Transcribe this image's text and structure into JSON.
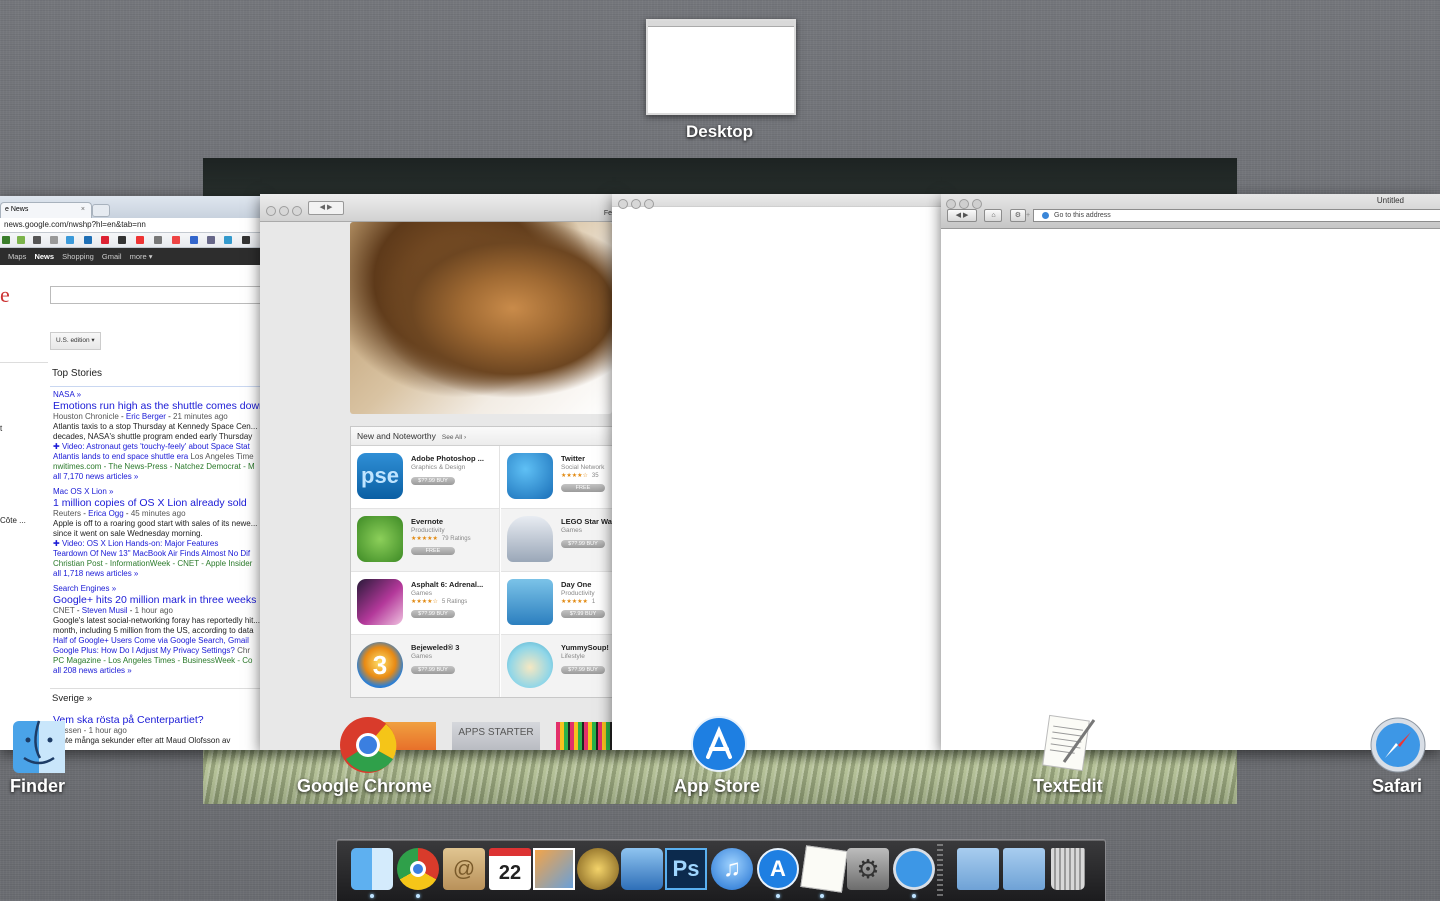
{
  "desktop": {
    "label": "Desktop"
  },
  "app_labels": {
    "finder": "Finder",
    "chrome": "Google Chrome",
    "appstore": "App Store",
    "textedit": "TextEdit",
    "safari": "Safari"
  },
  "chrome_window": {
    "tab_title": "e News",
    "url": "news.google.com/nwshp?hl=en&tab=nn",
    "gbar": [
      "Maps",
      "News",
      "Shopping",
      "Gmail",
      "more ▾"
    ],
    "edition": "U.S. edition ▾",
    "top_stories": "Top Stories",
    "stories": [
      {
        "section": "NASA »",
        "headline": "Emotions run high as the shuttle comes down",
        "source": "Houston Chronicle",
        "author": "Eric Berger",
        "time": "21 minutes ago",
        "snippet": "Atlantis taxis to a stop Thursday at Kennedy Space Cen... decades, NASA's shuttle program ended early Thursday",
        "video": "Video: Astronaut gets 'touchy-feely' about Space Stat",
        "related": "Atlantis lands to end space shuttle era",
        "related_src": "Los Angeles Time",
        "more_src": "nwitimes.com - The News-Press - Natchez Democrat - M",
        "all": "all 7,170 news articles »"
      },
      {
        "section": "Mac OS X Lion »",
        "headline": "1 million copies of OS X Lion already sold",
        "source": "Reuters",
        "author": "Erica Ogg",
        "time": "45 minutes ago",
        "snippet": "Apple is off to a roaring good start with sales of its newe... since it went on sale Wednesday morning.",
        "video": "Video: OS X Lion Hands-on: Major Features",
        "related": "Teardown Of New 13\" MacBook Air Finds Almost No Dif",
        "related_src": "",
        "more_src": "Christian Post - InformationWeek - CNET - Apple Insider",
        "all": "all 1,718 news articles »"
      },
      {
        "section": "Search Engines »",
        "headline": "Google+ hits 20 million mark in three weeks",
        "source": "CNET",
        "author": "Steven Musil",
        "time": "1 hour ago",
        "snippet": "Google's latest social-networking foray has reportedly hit... month, including 5 million from the US, according to data",
        "video": "Half of Google+ Users Come via Google Search, Gmail",
        "related": "Google Plus: How Do I Adjust My Privacy Settings?",
        "related_src": "Chr",
        "more_src": "PC Magazine - Los Angeles Times - BusinessWeek - Co",
        "all": "all 208 news articles »"
      }
    ],
    "sverige": "Sverige »",
    "sverige_headline": "Vem ska rösta på Centerpartiet?",
    "sverige_src": "pressen - 1 hour ago",
    "sverige_snippet": "g inte många sekunder efter att Maud Olofsson av",
    "left_fragments": [
      "t",
      "Côte ..."
    ]
  },
  "appstore_window": {
    "title_fragment": "Fe",
    "nn_title": "New and Noteworthy",
    "see_all": "See All ›",
    "apps": [
      {
        "name": "Adobe Photoshop ...",
        "cat": "Graphics & Design",
        "stars": "",
        "ratings": "",
        "price": "$??.99 BUY"
      },
      {
        "name": "Twitter",
        "cat": "Social Network",
        "stars": "★★★★☆",
        "ratings": "35",
        "price": "FREE"
      },
      {
        "name": "Evernote",
        "cat": "Productivity",
        "stars": "★★★★★",
        "ratings": "79 Ratings",
        "price": "FREE"
      },
      {
        "name": "LEGO Star Wa",
        "cat": "Games",
        "stars": "",
        "ratings": "",
        "price": "$??.99 BUY"
      },
      {
        "name": "Asphalt 6: Adrenal...",
        "cat": "Games",
        "stars": "★★★★☆",
        "ratings": "5 Ratings",
        "price": "$??.99 BUY"
      },
      {
        "name": "Day One",
        "cat": "Productivity",
        "stars": "★★★★★",
        "ratings": "1",
        "price": "$?.99 BUY"
      },
      {
        "name": "Bejeweled® 3",
        "cat": "Games",
        "stars": "",
        "ratings": "",
        "price": "$??.99 BUY"
      },
      {
        "name": "YummySoup!",
        "cat": "Lifestyle",
        "stars": "",
        "ratings": "",
        "price": "$??.99 BUY"
      }
    ],
    "banner2": "APPS STARTER KIT"
  },
  "safari_window": {
    "title": "Untitled",
    "address_placeholder": "Go to this address"
  },
  "dock_items": [
    "Finder",
    "Google Chrome",
    "Address Book",
    "Calendar",
    "iPhoto",
    "Aperture",
    "Mission Control",
    "Photoshop",
    "iTunes",
    "App Store",
    "TextEdit",
    "System Preferences",
    "Safari",
    "Applications",
    "Documents",
    "Trash"
  ],
  "colors": {
    "link": "#1a1ad6",
    "accent_blue": "#2a7fe0"
  }
}
